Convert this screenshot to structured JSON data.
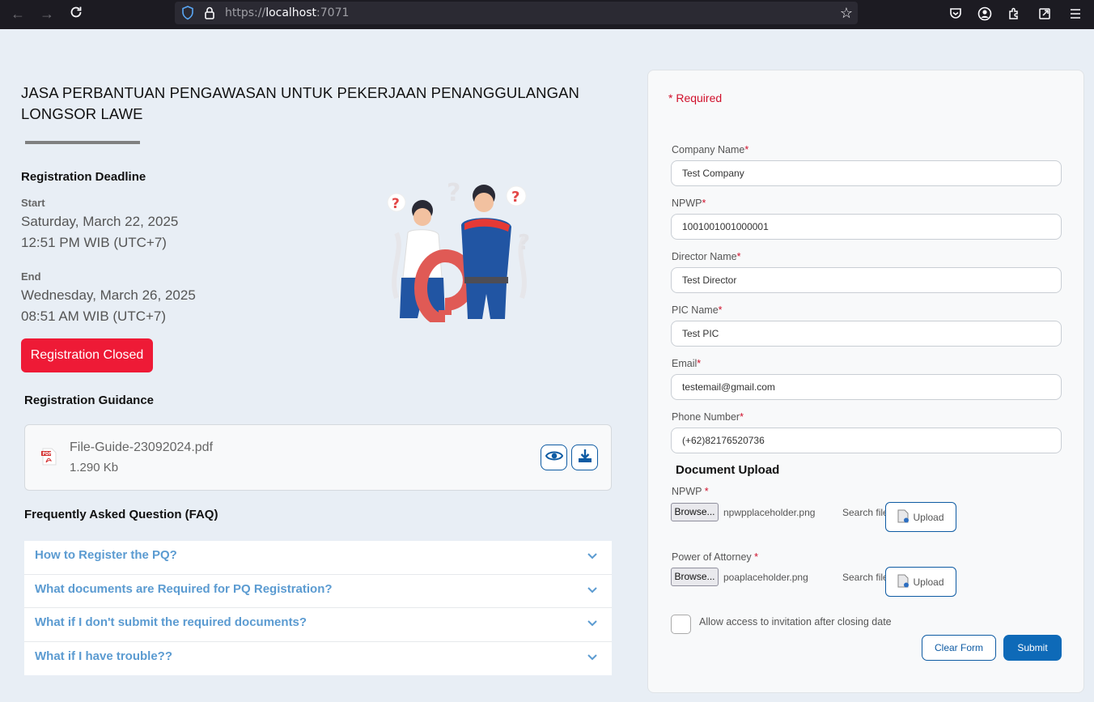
{
  "browser": {
    "url_prefix": "https://",
    "url_host": "localhost",
    "url_port": ":7071"
  },
  "event": {
    "title": "JASA PERBANTUAN PENGAWASAN UNTUK PEKERJAAN PENANGGULANGAN LONGSOR LAWE"
  },
  "deadline": {
    "heading": "Registration Deadline",
    "start_label": "Start",
    "start_date": "Saturday, March 22, 2025",
    "start_time": "12:51 PM WIB (UTC+7)",
    "end_label": "End",
    "end_date": "Wednesday, March 26, 2025",
    "end_time": "08:51 AM WIB (UTC+7)",
    "status_label": "Registration Closed",
    "status_color": "#ee1a36"
  },
  "guidance": {
    "heading": "Registration Guidance",
    "file_name": "File-Guide-23092024.pdf",
    "file_size": "1.290 Kb",
    "icons": [
      "pdf-icon",
      "eye-icon",
      "download-icon"
    ]
  },
  "faq": {
    "heading": "Frequently Asked Question (FAQ)",
    "items": [
      {
        "question": "How to Register the PQ?"
      },
      {
        "question": "What documents are Required for PQ Registration?"
      },
      {
        "question": "What if I don't submit the required documents?"
      },
      {
        "question": "What if I have trouble??"
      }
    ]
  },
  "form": {
    "required_note": "* Required",
    "fields": {
      "company_name": {
        "label": "Company Name",
        "value": "Test Company"
      },
      "npwp": {
        "label": "NPWP",
        "value": "1001001001000001"
      },
      "director_name": {
        "label": "Director Name",
        "value": "Test Director"
      },
      "pic_name": {
        "label": "PIC Name",
        "value": "Test PIC"
      },
      "email": {
        "label": "Email",
        "value": "testemail@gmail.com"
      },
      "phone": {
        "label": "Phone Number",
        "value": "(+62)82176520736"
      }
    },
    "required_star": "*",
    "document_upload": {
      "heading": "Document Upload",
      "npwp": {
        "label": "NPWP",
        "browse": "Browse...",
        "file": "npwpplaceholder.png",
        "search": "Search file",
        "upload": "Upload"
      },
      "poa": {
        "label": "Power of Attorney",
        "browse": "Browse...",
        "file": "poaplaceholder.png",
        "search": "Search file",
        "upload": "Upload"
      }
    },
    "allow_access_label": "Allow access to invitation after closing date",
    "clear_label": "Clear Form",
    "submit_label": "Submit",
    "accent_color": "#0e6ab8"
  }
}
